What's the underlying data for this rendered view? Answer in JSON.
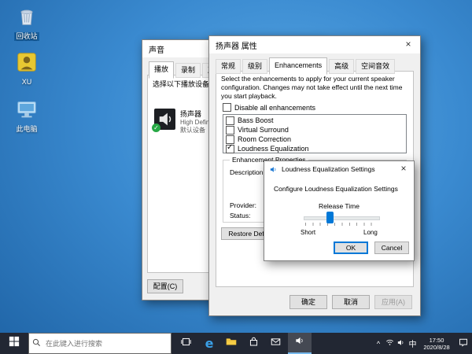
{
  "desktop": {
    "icons": [
      {
        "label": "回收站"
      },
      {
        "label": "XU"
      },
      {
        "label": "此电脑"
      }
    ]
  },
  "sound_dialog": {
    "title": "声音",
    "tabs": [
      {
        "label": "播放",
        "active": true
      },
      {
        "label": "录制",
        "active": false
      },
      {
        "label": "声音",
        "active": false
      }
    ],
    "instruction": "选择以下播放设备来修改设置:",
    "device": {
      "name": "扬声器",
      "detail": "High Defin...",
      "status": "默认设备"
    },
    "configure_button": "配置(C)"
  },
  "properties_dialog": {
    "title": "扬声器 属性",
    "tabs": [
      {
        "label": "常规",
        "active": false
      },
      {
        "label": "级别",
        "active": false
      },
      {
        "label": "Enhancements",
        "active": true
      },
      {
        "label": "高级",
        "active": false
      },
      {
        "label": "空间音效",
        "active": false
      }
    ],
    "intro": "Select the enhancements to apply for your current speaker configuration. Changes may not take effect until the next time you start playback.",
    "disable_all_label": "Disable all enhancements",
    "enhancements": [
      {
        "label": "Bass Boost",
        "checked": false
      },
      {
        "label": "Virtual Surround",
        "checked": false
      },
      {
        "label": "Room Correction",
        "checked": false
      },
      {
        "label": "Loudness Equalization",
        "checked": true
      }
    ],
    "group_title": "Enhancement Properties",
    "description_label": "Description:",
    "provider_label": "Provider:",
    "status_label": "Status:",
    "restore_defaults_button": "Restore Defaults",
    "ok_button": "确定",
    "cancel_button": "取消",
    "apply_button": "应用(A)"
  },
  "loudness_dialog": {
    "title": "Loudness Equalization Settings",
    "subtitle": "Configure Loudness Equalization Settings",
    "slider_label": "Release Time",
    "min_label": "Short",
    "max_label": "Long",
    "value_percent": 35,
    "ok_button": "OK",
    "cancel_button": "Cancel"
  },
  "taskbar": {
    "search_placeholder": "在此键入进行搜索",
    "ime": "中",
    "clock": {
      "time": "17:50",
      "date": "2020/8/28"
    }
  },
  "icons": {
    "close": "×",
    "check": "✓",
    "chevron_up": "^",
    "edge_letter": "e"
  },
  "colors": {
    "accent": "#0078d7",
    "taskbar_bg": "#222733",
    "desktop_blue": "#3a8ad0"
  }
}
